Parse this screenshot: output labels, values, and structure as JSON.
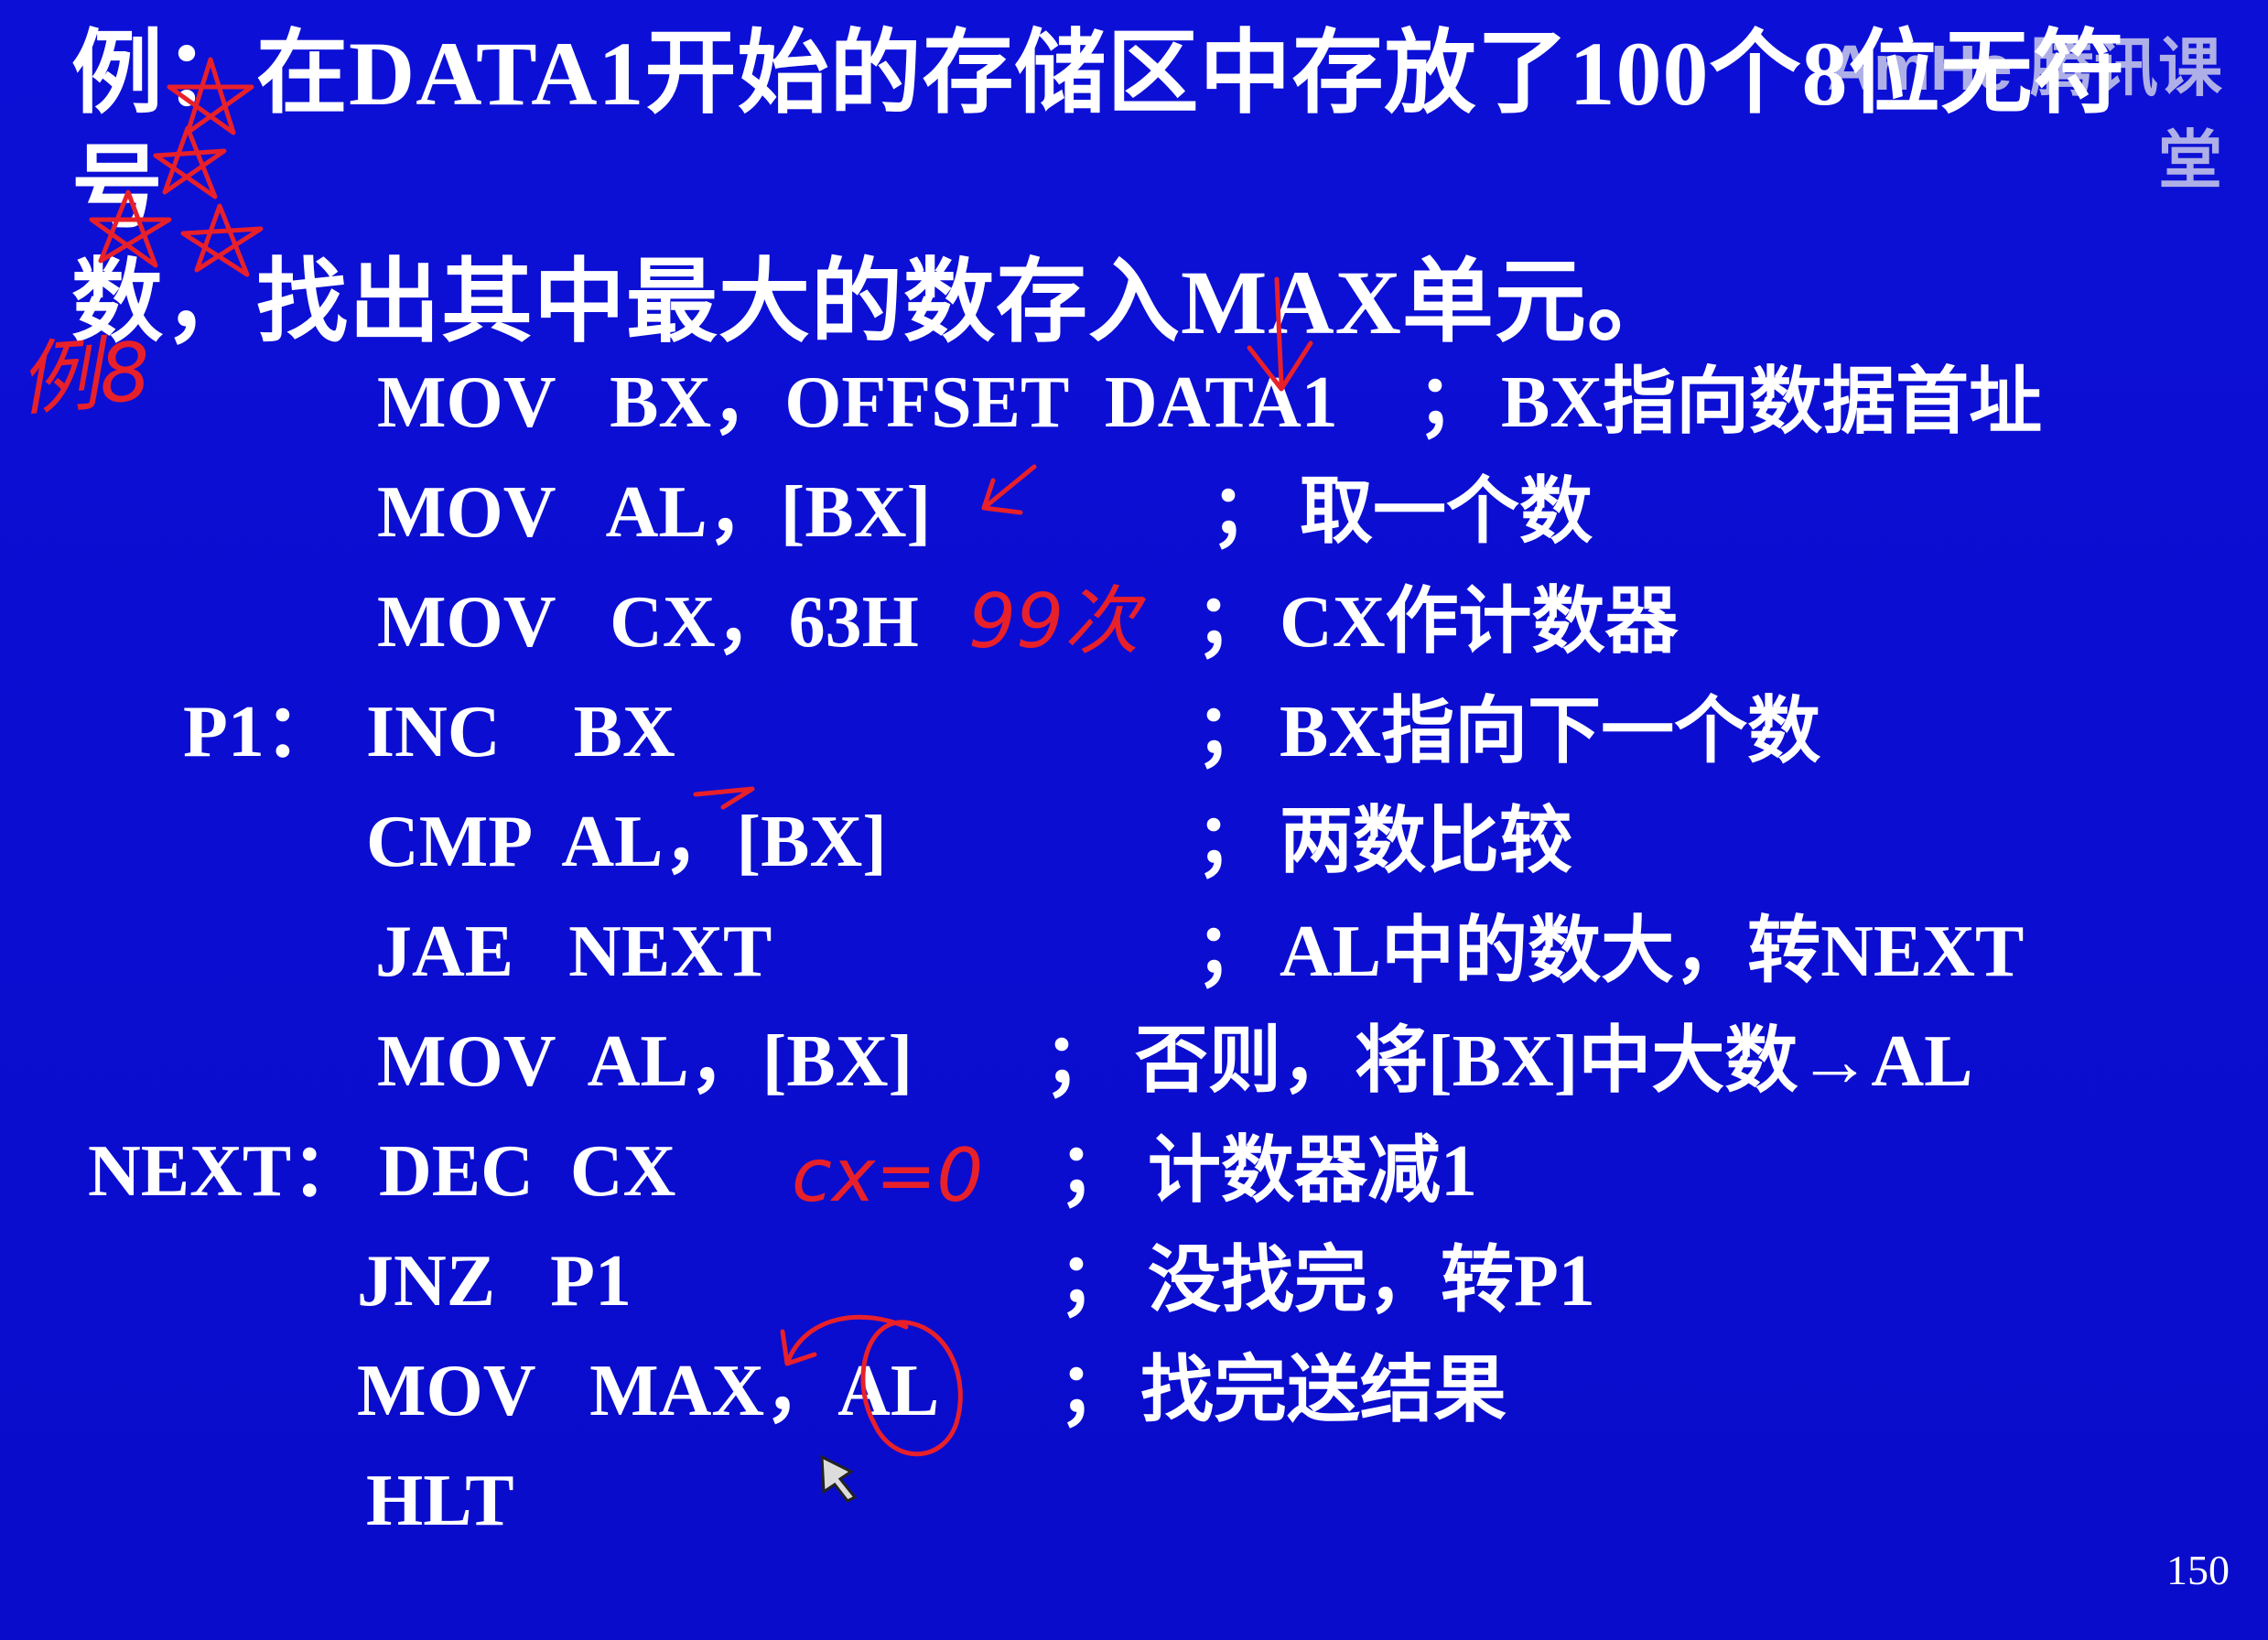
{
  "title": {
    "line1": "例：在DATA1开始的存储区中存放了100个8位无符号",
    "line2": "数，找出其中最大的数存入MAX单元。"
  },
  "code": [
    {
      "label": "",
      "instr": "MOV   BX，OFFSET  DATA1",
      "comment": "BX指向数据首址"
    },
    {
      "label": "",
      "instr": "MOV   AL，[BX]",
      "comment": "取一个数"
    },
    {
      "label": "",
      "instr": "MOV   CX，63H",
      "comment": "CX作计数器"
    },
    {
      "label": "P1：",
      "instr": "INC    BX",
      "comment": "BX指向下一个数"
    },
    {
      "label": "",
      "instr": "CMP  AL，[BX]",
      "comment": "两数比较"
    },
    {
      "label": "",
      "instr": "JAE   NEXT",
      "comment": "AL中的数大，转NEXT"
    },
    {
      "label": "",
      "instr": "MOV  AL，[BX]",
      "comment": "否则，将[BX]中大数→AL"
    },
    {
      "label": "NEXT：",
      "instr": "DEC  CX",
      "comment": "计数器减1"
    },
    {
      "label": "",
      "instr": "JNZ   P1",
      "comment": "没找完，转P1"
    },
    {
      "label": "",
      "instr": "MOV   MAX，AL",
      "comment": "找完送结果"
    },
    {
      "label": "",
      "instr": "HLT",
      "comment": ""
    }
  ],
  "semicolon": "；",
  "page_number": "150",
  "watermark": "AmHe 腾讯课堂",
  "colors": {
    "background": "#0c10d6",
    "text": "#ffffff",
    "annotation": "#e8202a"
  },
  "handwritten": {
    "example_note": "例8",
    "count_note": "99次",
    "cx_note": "cx=0"
  }
}
